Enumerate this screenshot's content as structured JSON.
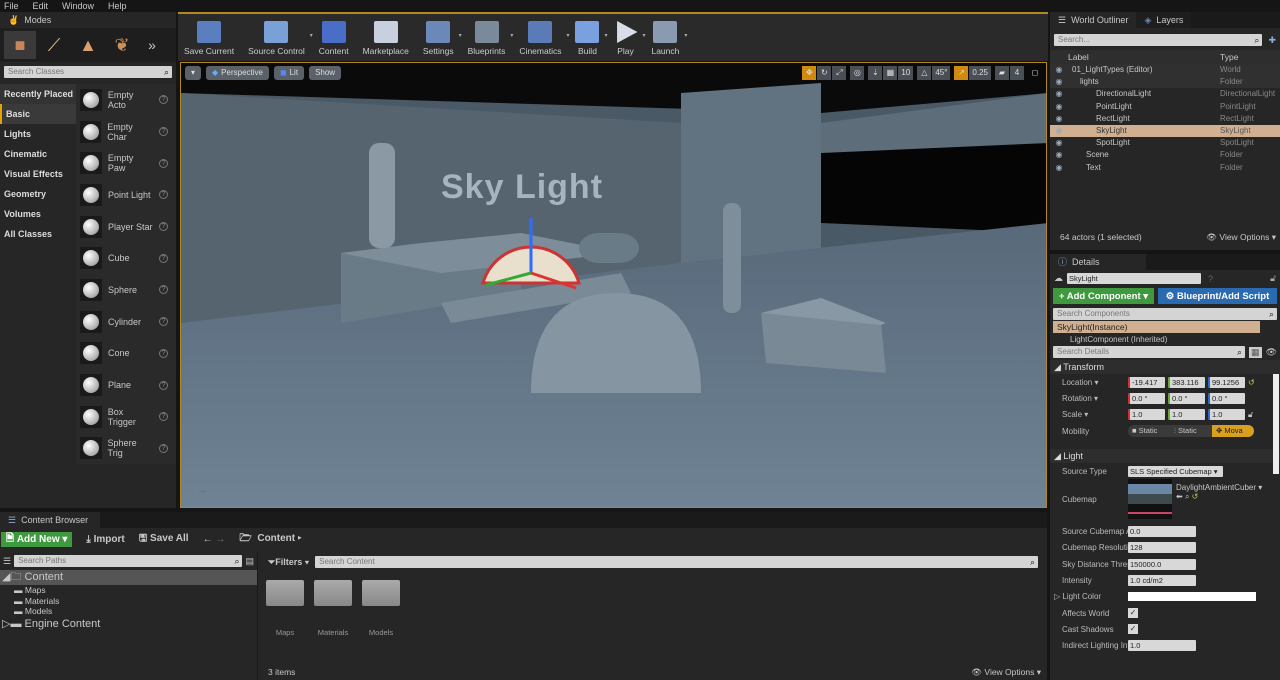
{
  "menu": [
    "File",
    "Edit",
    "Window",
    "Help"
  ],
  "modes": {
    "tab": "Modes",
    "search_placeholder": "Search Classes",
    "categories": [
      "Recently Placed",
      "Basic",
      "Lights",
      "Cinematic",
      "Visual Effects",
      "Geometry",
      "Volumes",
      "All Classes"
    ],
    "items": [
      "Empty Acto",
      "Empty Char",
      "Empty Paw",
      "Point Light",
      "Player Star",
      "Cube",
      "Sphere",
      "Cylinder",
      "Cone",
      "Plane",
      "Box Trigger",
      "Sphere Trig"
    ]
  },
  "toolbar": [
    "Save Current",
    "Source Control",
    "Content",
    "Marketplace",
    "Settings",
    "Blueprints",
    "Cinematics",
    "Build",
    "Play",
    "Launch"
  ],
  "viewport": {
    "perspective": "Perspective",
    "lit": "Lit",
    "show": "Show",
    "grid": "10",
    "angle": "45°",
    "scale": "0.25",
    "cam": "4",
    "scene_text": "Sky Light"
  },
  "outliner": {
    "tab": "World Outliner",
    "tab2": "Layers",
    "search_placeholder": "Search...",
    "col_label": "Label",
    "col_type": "Type",
    "rows": [
      {
        "label": "01_LightTypes (Editor)",
        "type": "World"
      },
      {
        "label": "lights",
        "type": "Folder"
      },
      {
        "label": "DirectionalLight",
        "type": "DirectionalLight"
      },
      {
        "label": "PointLight",
        "type": "PointLight"
      },
      {
        "label": "RectLight",
        "type": "RectLight"
      },
      {
        "label": "SkyLight",
        "type": "SkyLight"
      },
      {
        "label": "SpotLight",
        "type": "SpotLight"
      },
      {
        "label": "Scene",
        "type": "Folder"
      },
      {
        "label": "Text",
        "type": "Folder"
      }
    ],
    "status": "64 actors (1 selected)",
    "view_options": "View Options"
  },
  "details": {
    "tab": "Details",
    "name": "SkyLight",
    "add_component": "+ Add Component",
    "blueprint": "Blueprint/Add Script",
    "search_components": "Search Components",
    "component_instance": "SkyLight(Instance)",
    "component_inherited": "LightComponent (Inherited)",
    "search_details": "Search Details",
    "transform": "Transform",
    "location_label": "Location",
    "location": [
      "-19.417",
      "383.116",
      "99.1256"
    ],
    "rotation_label": "Rotation",
    "rotation": [
      "0.0 °",
      "0.0 °",
      "0.0 °"
    ],
    "scale_label": "Scale",
    "scale": [
      "1.0",
      "1.0",
      "1.0"
    ],
    "mobility_label": "Mobility",
    "mobility": [
      "Static",
      "Static",
      "Mova"
    ],
    "light": "Light",
    "source_type_label": "Source Type",
    "source_type": "SLS Specified Cubemap",
    "cubemap_label": "Cubemap",
    "cubemap": "DaylightAmbientCuber",
    "props": [
      {
        "label": "Source Cubemap Ar",
        "value": "0.0"
      },
      {
        "label": "Cubemap Resolutio",
        "value": "128"
      },
      {
        "label": "Sky Distance Thres",
        "value": "150000.0"
      },
      {
        "label": "Intensity",
        "value": "1.0 cd/m2"
      }
    ],
    "light_color": "Light Color",
    "affects_world": "Affects World",
    "cast_shadows": "Cast Shadows",
    "indirect_label": "Indirect Lighting Int",
    "indirect": "1.0"
  },
  "content": {
    "tab": "Content Browser",
    "add_new": "Add New",
    "import": "Import",
    "save_all": "Save All",
    "path": "Content",
    "search_paths": "Search Paths",
    "filters": "Filters",
    "search_content": "Search Content",
    "tree": [
      "Content",
      "Maps",
      "Materials",
      "Models",
      "Engine Content"
    ],
    "folders": [
      "Maps",
      "Materials",
      "Models"
    ],
    "count": "3 items",
    "view_options": "View Options"
  }
}
